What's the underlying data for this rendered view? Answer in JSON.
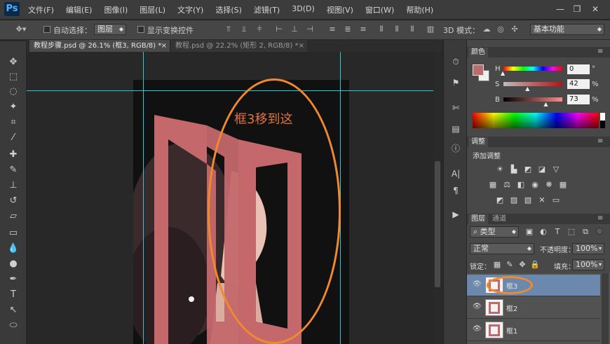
{
  "app": {
    "logo": "Ps"
  },
  "menu": [
    "文件(F)",
    "编辑(E)",
    "图像(I)",
    "图层(L)",
    "文字(Y)",
    "选择(S)",
    "滤镜(T)",
    "3D(D)",
    "视图(V)",
    "窗口(W)",
    "帮助(H)"
  ],
  "window_controls": {
    "minimize": "—",
    "restore": "❐",
    "close": "✕"
  },
  "options": {
    "auto_select_label": "自动选择：",
    "auto_select_value": "图层",
    "show_transform_label": "显示变换控件",
    "mode_3d_label": "3D 模式：",
    "workspace": "基本功能"
  },
  "tabs": [
    {
      "label": "教程步骤.psd @ 26.1% (框3, RGB/8) *",
      "close": "×"
    },
    {
      "label": "教程.psd @ 22.2% (矩形 2, RGB/8) *",
      "close": "×"
    }
  ],
  "canvas": {
    "annotation": "框3移到这",
    "accent_color": "#f08a2c",
    "frame_color": "#c4686c"
  },
  "color_panel": {
    "title": "颜色",
    "h_label": "H",
    "h_value": "0",
    "h_unit": "°",
    "s_label": "S",
    "s_value": "42",
    "s_unit": "%",
    "b_label": "B",
    "b_value": "73",
    "b_unit": "%",
    "h_level": 0,
    "s_level": 0.42,
    "b_level": 0.73,
    "swatch": "#bb6c6c"
  },
  "adjust_panel": {
    "title": "调整",
    "subtitle": "添加调整"
  },
  "layers_panel": {
    "tabs": [
      "图层",
      "通道"
    ],
    "filter_type": "类型",
    "blend_mode": "正常",
    "opacity_label": "不透明度：",
    "opacity_value": "100%",
    "lock_label": "锁定：",
    "fill_label": "填充：",
    "fill_value": "100%",
    "layers": [
      {
        "name": "框3",
        "selected": true
      },
      {
        "name": "框2",
        "selected": false
      },
      {
        "name": "框1",
        "selected": false
      }
    ]
  }
}
